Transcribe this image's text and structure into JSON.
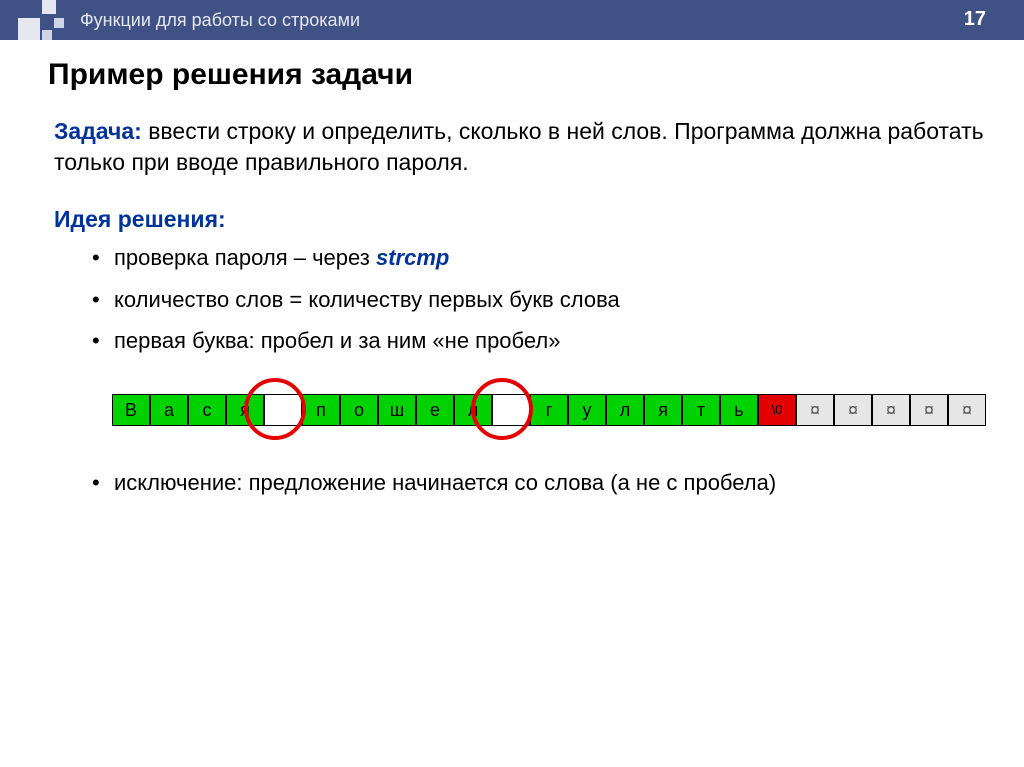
{
  "header": {
    "title": "Функции для работы со строками",
    "page_number": "17"
  },
  "page_title": "Пример решения задачи",
  "task": {
    "label": "Задача:",
    "text": " ввести строку и определить, сколько в ней слов. Программа должна работать только при вводе правильного пароля."
  },
  "idea": {
    "label": "Идея решения:",
    "bullets": [
      {
        "pre": "проверка пароля – через ",
        "code": "strcmp",
        "post": ""
      },
      {
        "pre": "количество слов = количеству первых букв слова",
        "code": "",
        "post": ""
      },
      {
        "pre": "первая буква: пробел и за ним «не пробел»",
        "code": "",
        "post": ""
      }
    ],
    "final_bullet": "исключение: предложение начинается со слова (а не с пробела)"
  },
  "diagram": {
    "cells": [
      {
        "ch": "В",
        "cls": ""
      },
      {
        "ch": "а",
        "cls": ""
      },
      {
        "ch": "с",
        "cls": ""
      },
      {
        "ch": "я",
        "cls": ""
      },
      {
        "ch": "",
        "cls": "space"
      },
      {
        "ch": "п",
        "cls": ""
      },
      {
        "ch": "о",
        "cls": ""
      },
      {
        "ch": "ш",
        "cls": ""
      },
      {
        "ch": "е",
        "cls": ""
      },
      {
        "ch": "л",
        "cls": ""
      },
      {
        "ch": "",
        "cls": "space"
      },
      {
        "ch": "г",
        "cls": ""
      },
      {
        "ch": "у",
        "cls": ""
      },
      {
        "ch": "л",
        "cls": ""
      },
      {
        "ch": "я",
        "cls": ""
      },
      {
        "ch": "т",
        "cls": ""
      },
      {
        "ch": "ь",
        "cls": ""
      },
      {
        "ch": "\\0",
        "cls": "null"
      },
      {
        "ch": "¤",
        "cls": "junk"
      },
      {
        "ch": "¤",
        "cls": "junk"
      },
      {
        "ch": "¤",
        "cls": "junk"
      },
      {
        "ch": "¤",
        "cls": "junk"
      },
      {
        "ch": "¤",
        "cls": "junk"
      }
    ]
  }
}
